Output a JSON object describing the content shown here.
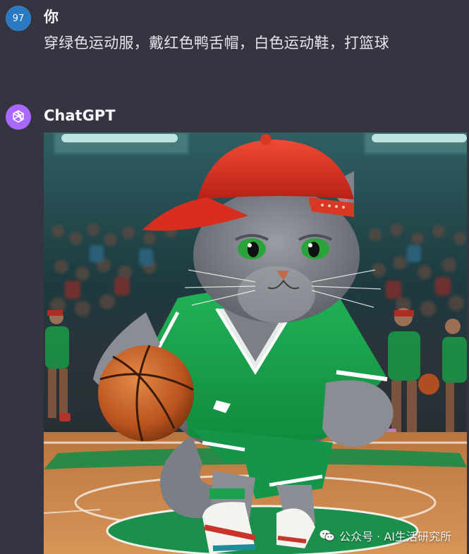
{
  "user_message": {
    "avatar_text": "97",
    "author": "你",
    "text": "穿绿色运动服，戴红色鸭舌帽，白色运动鞋，打篮球"
  },
  "assistant_message": {
    "avatar_icon": "openai-logo-icon",
    "author": "ChatGPT"
  },
  "watermark": {
    "text": "公众号 · AI生活研究所",
    "icon": "wechat-icon"
  },
  "colors": {
    "background": "#343541",
    "user_avatar": "#2a7ac3",
    "gpt_avatar": "#ab68ff"
  }
}
